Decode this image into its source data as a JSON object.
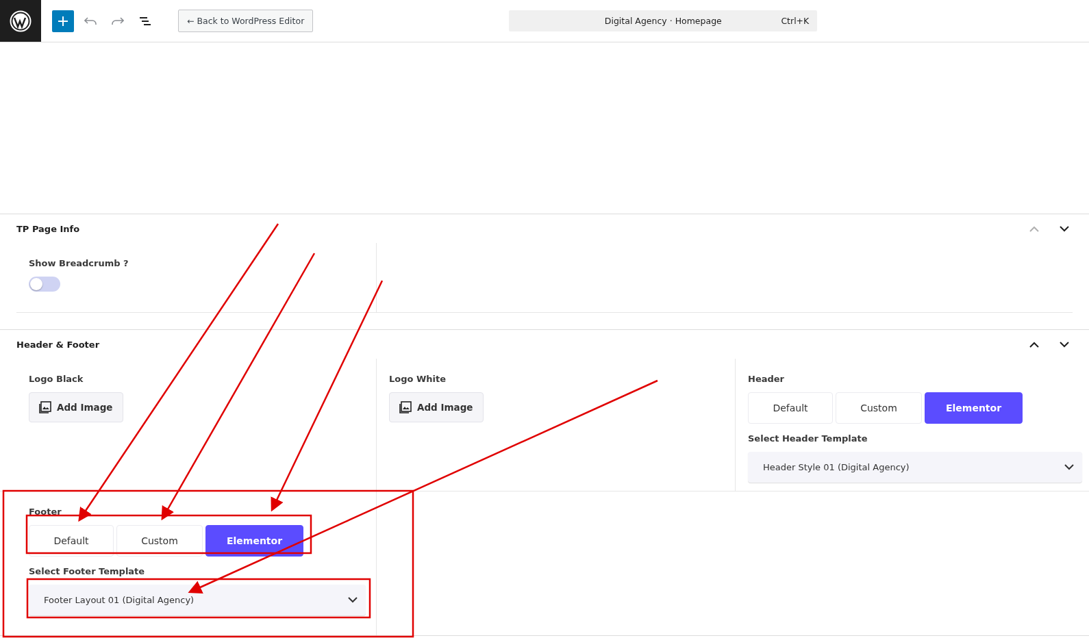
{
  "toolbar": {
    "back_button": "← Back to WordPress Editor",
    "command_bar": {
      "title": "Digital Agency · Homepage",
      "shortcut": "Ctrl+K"
    }
  },
  "panels": [
    {
      "title": "TP Page Info",
      "move_up_disabled": true,
      "fields": [
        {
          "kind": "toggle",
          "label": "Show Breadcrumb ?",
          "on": false
        }
      ]
    },
    {
      "title": "Header & Footer",
      "move_up_disabled": false,
      "fields": [
        {
          "kind": "image",
          "label": "Logo Black",
          "button": "Add Image"
        },
        {
          "kind": "image",
          "label": "Logo White",
          "button": "Add Image"
        },
        {
          "kind": "choice",
          "label": "Header",
          "options": [
            {
              "label": "Default",
              "selected": false
            },
            {
              "label": "Custom",
              "selected": false
            },
            {
              "label": "Elementor",
              "selected": true
            }
          ],
          "select_label": "Select Header Template",
          "select_value": "Header Style 01 (Digital Agency)"
        },
        {
          "kind": "choice",
          "label": "Footer",
          "options": [
            {
              "label": "Default",
              "selected": false
            },
            {
              "label": "Custom",
              "selected": false
            },
            {
              "label": "Elementor",
              "selected": true
            }
          ],
          "select_label": "Select Footer Template",
          "select_value": "Footer Layout 01 (Digital Agency)"
        }
      ]
    }
  ]
}
